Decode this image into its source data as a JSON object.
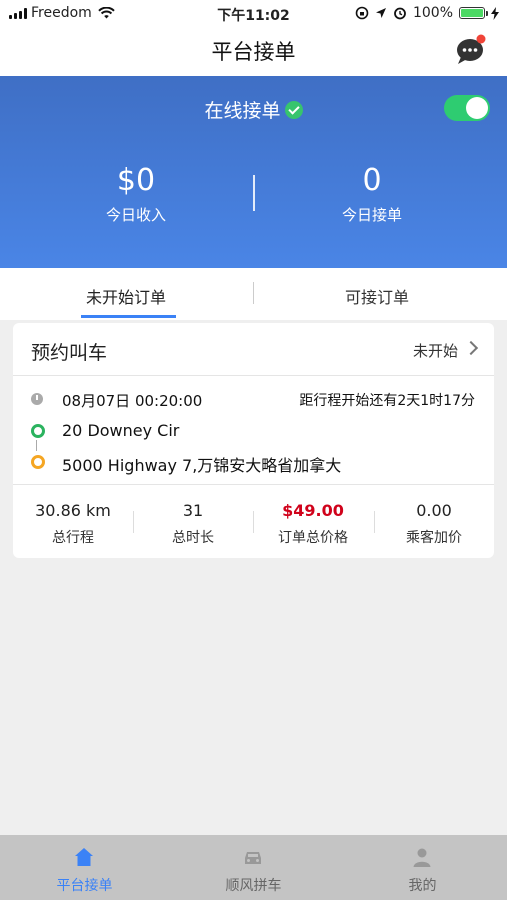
{
  "status_bar": {
    "carrier": "Freedom",
    "time": "下午11:02",
    "battery": "100%"
  },
  "nav": {
    "title": "平台接单"
  },
  "hero": {
    "online_label": "在线接单",
    "online_toggle_on": true,
    "income_value": "$0",
    "income_label": "今日收入",
    "orders_value": "0",
    "orders_label": "今日接单"
  },
  "tabs": [
    {
      "label": "未开始订单",
      "active": true
    },
    {
      "label": "可接订单",
      "active": false
    }
  ],
  "order_card": {
    "title": "预约叫车",
    "status": "未开始",
    "datetime": "08月07日 00:20:00",
    "countdown": "距行程开始还有2天1时17分",
    "origin": "20 Downey Cir",
    "destination": "5000 Highway 7,万锦安大略省加拿大",
    "metrics": [
      {
        "value": "30.86 km",
        "label": "总行程"
      },
      {
        "value": "31",
        "label": "总时长"
      },
      {
        "value": "$49.00",
        "label": "订单总价格"
      },
      {
        "value": "0.00",
        "label": "乘客加价"
      }
    ]
  },
  "bottom_nav": [
    {
      "label": "平台接单",
      "icon": "home-icon",
      "active": true
    },
    {
      "label": "顺风拼车",
      "icon": "car-icon",
      "active": false
    },
    {
      "label": "我的",
      "icon": "person-icon",
      "active": false
    }
  ],
  "colors": {
    "accent": "#3b82f6",
    "hero_top": "#3f6fc5",
    "hero_bottom": "#4a85e6",
    "price": "#d0021b",
    "toggle_on": "#2ecc71"
  }
}
